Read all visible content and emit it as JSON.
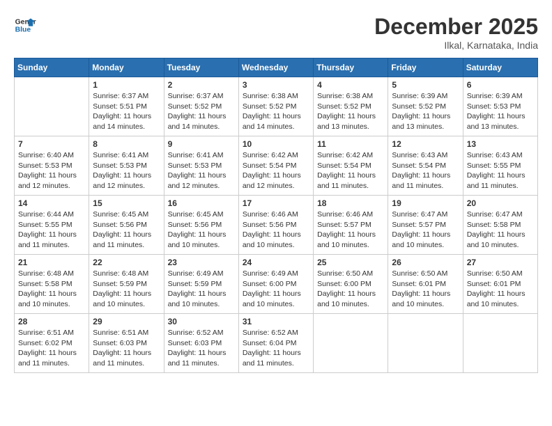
{
  "logo": {
    "line1": "General",
    "line2": "Blue"
  },
  "title": "December 2025",
  "subtitle": "Ilkal, Karnataka, India",
  "weekdays": [
    "Sunday",
    "Monday",
    "Tuesday",
    "Wednesday",
    "Thursday",
    "Friday",
    "Saturday"
  ],
  "weeks": [
    [
      {
        "day": "",
        "sunrise": "",
        "sunset": "",
        "daylight": ""
      },
      {
        "day": "1",
        "sunrise": "Sunrise: 6:37 AM",
        "sunset": "Sunset: 5:51 PM",
        "daylight": "Daylight: 11 hours and 14 minutes."
      },
      {
        "day": "2",
        "sunrise": "Sunrise: 6:37 AM",
        "sunset": "Sunset: 5:52 PM",
        "daylight": "Daylight: 11 hours and 14 minutes."
      },
      {
        "day": "3",
        "sunrise": "Sunrise: 6:38 AM",
        "sunset": "Sunset: 5:52 PM",
        "daylight": "Daylight: 11 hours and 14 minutes."
      },
      {
        "day": "4",
        "sunrise": "Sunrise: 6:38 AM",
        "sunset": "Sunset: 5:52 PM",
        "daylight": "Daylight: 11 hours and 13 minutes."
      },
      {
        "day": "5",
        "sunrise": "Sunrise: 6:39 AM",
        "sunset": "Sunset: 5:52 PM",
        "daylight": "Daylight: 11 hours and 13 minutes."
      },
      {
        "day": "6",
        "sunrise": "Sunrise: 6:39 AM",
        "sunset": "Sunset: 5:53 PM",
        "daylight": "Daylight: 11 hours and 13 minutes."
      }
    ],
    [
      {
        "day": "7",
        "sunrise": "Sunrise: 6:40 AM",
        "sunset": "Sunset: 5:53 PM",
        "daylight": "Daylight: 11 hours and 12 minutes."
      },
      {
        "day": "8",
        "sunrise": "Sunrise: 6:41 AM",
        "sunset": "Sunset: 5:53 PM",
        "daylight": "Daylight: 11 hours and 12 minutes."
      },
      {
        "day": "9",
        "sunrise": "Sunrise: 6:41 AM",
        "sunset": "Sunset: 5:53 PM",
        "daylight": "Daylight: 11 hours and 12 minutes."
      },
      {
        "day": "10",
        "sunrise": "Sunrise: 6:42 AM",
        "sunset": "Sunset: 5:54 PM",
        "daylight": "Daylight: 11 hours and 12 minutes."
      },
      {
        "day": "11",
        "sunrise": "Sunrise: 6:42 AM",
        "sunset": "Sunset: 5:54 PM",
        "daylight": "Daylight: 11 hours and 11 minutes."
      },
      {
        "day": "12",
        "sunrise": "Sunrise: 6:43 AM",
        "sunset": "Sunset: 5:54 PM",
        "daylight": "Daylight: 11 hours and 11 minutes."
      },
      {
        "day": "13",
        "sunrise": "Sunrise: 6:43 AM",
        "sunset": "Sunset: 5:55 PM",
        "daylight": "Daylight: 11 hours and 11 minutes."
      }
    ],
    [
      {
        "day": "14",
        "sunrise": "Sunrise: 6:44 AM",
        "sunset": "Sunset: 5:55 PM",
        "daylight": "Daylight: 11 hours and 11 minutes."
      },
      {
        "day": "15",
        "sunrise": "Sunrise: 6:45 AM",
        "sunset": "Sunset: 5:56 PM",
        "daylight": "Daylight: 11 hours and 11 minutes."
      },
      {
        "day": "16",
        "sunrise": "Sunrise: 6:45 AM",
        "sunset": "Sunset: 5:56 PM",
        "daylight": "Daylight: 11 hours and 10 minutes."
      },
      {
        "day": "17",
        "sunrise": "Sunrise: 6:46 AM",
        "sunset": "Sunset: 5:56 PM",
        "daylight": "Daylight: 11 hours and 10 minutes."
      },
      {
        "day": "18",
        "sunrise": "Sunrise: 6:46 AM",
        "sunset": "Sunset: 5:57 PM",
        "daylight": "Daylight: 11 hours and 10 minutes."
      },
      {
        "day": "19",
        "sunrise": "Sunrise: 6:47 AM",
        "sunset": "Sunset: 5:57 PM",
        "daylight": "Daylight: 11 hours and 10 minutes."
      },
      {
        "day": "20",
        "sunrise": "Sunrise: 6:47 AM",
        "sunset": "Sunset: 5:58 PM",
        "daylight": "Daylight: 11 hours and 10 minutes."
      }
    ],
    [
      {
        "day": "21",
        "sunrise": "Sunrise: 6:48 AM",
        "sunset": "Sunset: 5:58 PM",
        "daylight": "Daylight: 11 hours and 10 minutes."
      },
      {
        "day": "22",
        "sunrise": "Sunrise: 6:48 AM",
        "sunset": "Sunset: 5:59 PM",
        "daylight": "Daylight: 11 hours and 10 minutes."
      },
      {
        "day": "23",
        "sunrise": "Sunrise: 6:49 AM",
        "sunset": "Sunset: 5:59 PM",
        "daylight": "Daylight: 11 hours and 10 minutes."
      },
      {
        "day": "24",
        "sunrise": "Sunrise: 6:49 AM",
        "sunset": "Sunset: 6:00 PM",
        "daylight": "Daylight: 11 hours and 10 minutes."
      },
      {
        "day": "25",
        "sunrise": "Sunrise: 6:50 AM",
        "sunset": "Sunset: 6:00 PM",
        "daylight": "Daylight: 11 hours and 10 minutes."
      },
      {
        "day": "26",
        "sunrise": "Sunrise: 6:50 AM",
        "sunset": "Sunset: 6:01 PM",
        "daylight": "Daylight: 11 hours and 10 minutes."
      },
      {
        "day": "27",
        "sunrise": "Sunrise: 6:50 AM",
        "sunset": "Sunset: 6:01 PM",
        "daylight": "Daylight: 11 hours and 10 minutes."
      }
    ],
    [
      {
        "day": "28",
        "sunrise": "Sunrise: 6:51 AM",
        "sunset": "Sunset: 6:02 PM",
        "daylight": "Daylight: 11 hours and 11 minutes."
      },
      {
        "day": "29",
        "sunrise": "Sunrise: 6:51 AM",
        "sunset": "Sunset: 6:03 PM",
        "daylight": "Daylight: 11 hours and 11 minutes."
      },
      {
        "day": "30",
        "sunrise": "Sunrise: 6:52 AM",
        "sunset": "Sunset: 6:03 PM",
        "daylight": "Daylight: 11 hours and 11 minutes."
      },
      {
        "day": "31",
        "sunrise": "Sunrise: 6:52 AM",
        "sunset": "Sunset: 6:04 PM",
        "daylight": "Daylight: 11 hours and 11 minutes."
      },
      {
        "day": "",
        "sunrise": "",
        "sunset": "",
        "daylight": ""
      },
      {
        "day": "",
        "sunrise": "",
        "sunset": "",
        "daylight": ""
      },
      {
        "day": "",
        "sunrise": "",
        "sunset": "",
        "daylight": ""
      }
    ]
  ]
}
